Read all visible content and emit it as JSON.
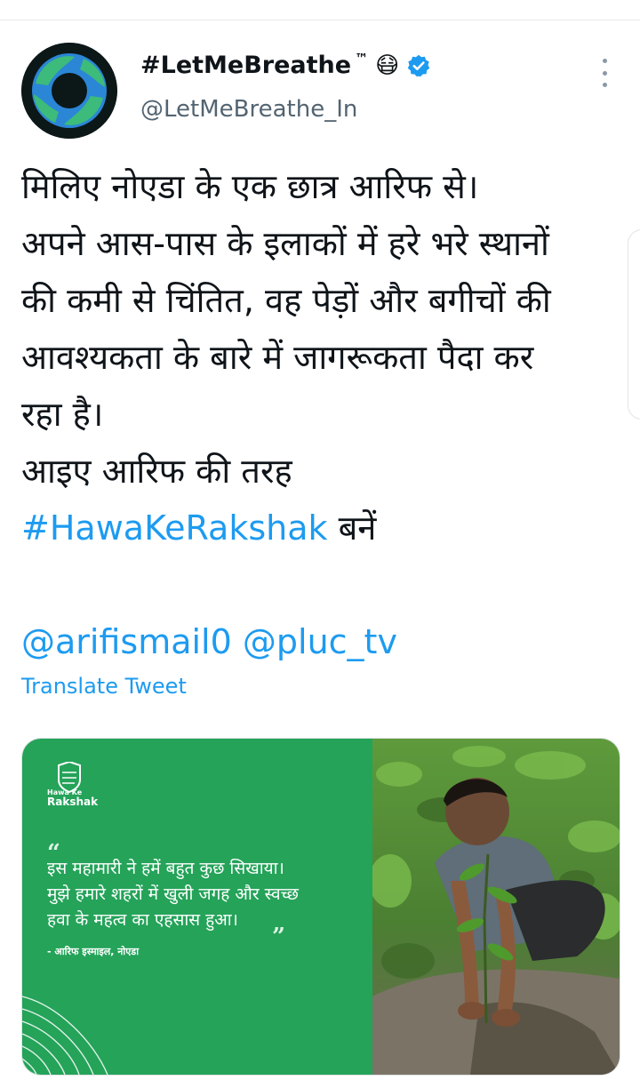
{
  "tweet": {
    "author": {
      "display_name": "#LetMeBreathe",
      "trademark": "™",
      "emoji": "😷",
      "handle": "@LetMeBreathe_In",
      "verified": true
    },
    "text_lines": [
      "मिलिए नोएडा के एक छात्र आरिफ से।",
      "अपने आस-पास के इलाकों में हरे भरे स्थानों",
      "की कमी से चिंतित, वह पेड़ों और बगीचों की",
      "आवश्यकता के बारे में जागरूकता पैदा कर",
      "रहा है।",
      "आइए आरिफ की तरह"
    ],
    "hashtag": "#HawaKeRakshak",
    "hashtag_suffix": " बनें",
    "mention_1": "@arifismail0",
    "mention_2": "@pluc_tv",
    "translate_label": "Translate Tweet"
  },
  "media": {
    "brand_line_1": "Hawa Ke",
    "brand_line_2": "Rakshak",
    "open_quote": "“",
    "close_quote": "”",
    "quote_lines": [
      "इस महामारी ने हमें बहुत कुछ सिखाया।",
      "मुझे हमारे शहरों में खुली जगह और स्वच्छ",
      "हवा के महत्व का एहसास हुआ।"
    ],
    "attribution": "- आरिफ इस्माइल, नोएडा"
  },
  "colors": {
    "link": "#1d9bf0",
    "card_green": "#24a359",
    "verified_badge": "#1d9bf0"
  },
  "icons": {
    "more": "more-vertical-icon",
    "verified": "verified-badge-icon",
    "brand": "shield-icon"
  }
}
